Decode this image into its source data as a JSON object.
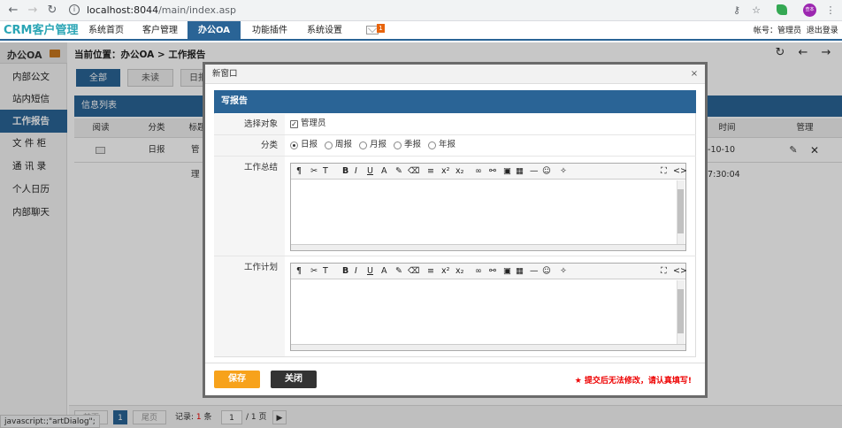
{
  "browser": {
    "url_host": "localhost:8044",
    "url_path": "/main/index.asp",
    "profile_initials": "查本"
  },
  "app": {
    "logo": "CRM客户管理",
    "nav": [
      "系统首页",
      "客户管理",
      "办公OA",
      "功能插件",
      "系统设置"
    ],
    "mail_badge": "1",
    "account_label": "帐号：管理员",
    "logout": "退出登录"
  },
  "sidebar": {
    "title": "办公OA",
    "items": [
      {
        "label": "内部公文"
      },
      {
        "label": "站内短信"
      },
      {
        "label": "工作报告"
      },
      {
        "label": "文 件 柜"
      },
      {
        "label": "通 讯 录"
      },
      {
        "label": "个人日历"
      },
      {
        "label": "内部聊天"
      }
    ]
  },
  "main": {
    "breadcrumb": "当前位置：办公OA > 工作报告",
    "tabs": [
      "全部",
      "未读",
      "日报"
    ],
    "list_title": "信息列表",
    "columns": [
      "阅读",
      "分类",
      "标题",
      "时间",
      "管理"
    ],
    "row": {
      "type": "日报",
      "title_fragment": "管理",
      "time": "5-10-10 17:30:04"
    }
  },
  "pager": {
    "prev": "前页",
    "page": "1",
    "next": "尾页",
    "records_label": "记录:",
    "records_count": "1",
    "records_unit": "条",
    "page_input": "1",
    "page_total": "/ 1 页"
  },
  "status_bar": "javascript:;\"artDialog\";",
  "dialog": {
    "title": "新窗口",
    "close": "×",
    "form_title": "写报告",
    "target_label": "选择对象",
    "target_option": "管理员",
    "category_label": "分类",
    "categories": [
      "日报",
      "周报",
      "月报",
      "季报",
      "年报"
    ],
    "summary_label": "工作总结",
    "plan_label": "工作计划",
    "toolbar": [
      "¶",
      "✂",
      "T",
      "B",
      "I",
      "U",
      "A",
      "✎",
      "⌫",
      "≡",
      "x²",
      "x₂",
      "∞",
      "⚯",
      "▣",
      "▦",
      "—",
      "☺",
      "✧",
      "⛶",
      "<>"
    ],
    "save": "保存",
    "close_btn": "关闭",
    "warning": "★ 提交后无法修改，请认真填写!"
  }
}
